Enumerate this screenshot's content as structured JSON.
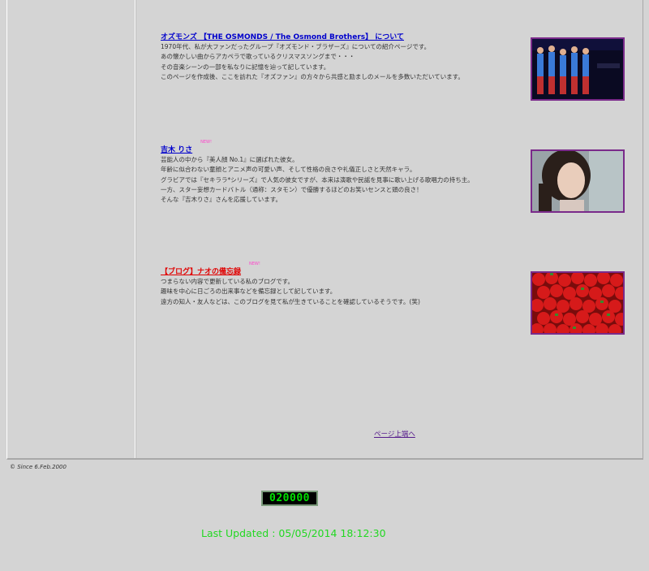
{
  "sections": [
    {
      "title": "オズモンズ 【THE OSMONDS / The Osmond Brothers】 について",
      "badge": "",
      "lines": [
        "1970年代、私が大ファンだったグループ『オズモンド・ブラザーズ』についての紹介ページです。",
        "あの懐かしい曲からアカペラで歌っているクリスマスソングまで・・・",
        "その音楽シーンの一部を私なりに記憶を辿って記しています。",
        "このページを作成後、ここを訪れた『オズファン』の方々から共感と励ましのメールを多数いただいています。"
      ],
      "image": "band-photo"
    },
    {
      "title": "吉木 りさ",
      "badge": "NEW!",
      "lines": [
        "芸能人の中から『美人顔 No.1』に選ばれた彼女。",
        "年齢に似合わない童顔とアニメ声の可愛い声、そして性格の良さや礼儀正しさと天然キャラ。",
        "グラビアでは『セキララ*シリーズ』で人気の彼女ですが、本来は演歌や民謡を見事に歌い上げる歌唱力の持ち主。",
        "一方、スター妄想カードバトル（通称：スタモン）で優勝するほどのお笑いセンスと頭の良さ！",
        "そんな『吉木りさ』さんを応援しています。"
      ],
      "image": "portrait-photo"
    },
    {
      "title": "【ブログ】ナオの備忘録",
      "badge": "NEW!",
      "lines": [
        "つまらない内容で更新している私のブログです。",
        "趣味を中心に日ごろの出来事などを備忘録として記しています。",
        "遠方の知人・友人などは、このブログを見て私が生きていることを確認しているそうです。(笑)"
      ],
      "image": "strawberries-photo"
    }
  ],
  "page_top_link": "ページ上端へ",
  "since": "© Since 6.Feb.2000",
  "counter": "020000",
  "last_updated": "Last Updated : 05/05/2014 18:12:30",
  "colors": {
    "background": "#d4d4d4",
    "title_link": "#0000cc",
    "blog_link": "#e00000",
    "updated_text": "#22d822",
    "thumb_border": "#7a2a8a"
  }
}
